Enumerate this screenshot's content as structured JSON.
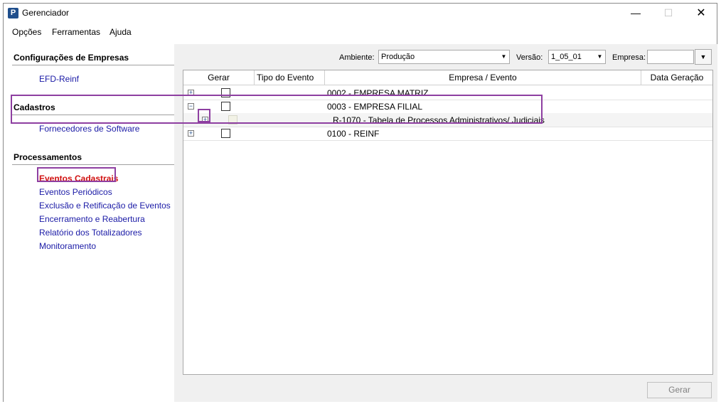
{
  "window": {
    "title": "Gerenciador",
    "app_icon": "P",
    "controls": {
      "minimize": "—",
      "maximize": "☐",
      "close": "✕"
    }
  },
  "menu": [
    "Opções",
    "Ferramentas",
    "Ajuda"
  ],
  "sidebar": {
    "sections": [
      {
        "title": "Configurações de Empresas",
        "links": [
          "EFD-Reinf"
        ]
      },
      {
        "title": "Cadastros",
        "links": [
          "Fornecedores de Software"
        ]
      },
      {
        "title": "Processamentos",
        "links": [
          "Eventos Cadastrais",
          "Eventos Periódicos",
          "Exclusão e Retificação de Eventos",
          "Encerramento e Reabertura",
          "Relatório dos Totalizadores",
          "Monitoramento"
        ]
      }
    ],
    "active_link": "Eventos Cadastrais"
  },
  "filters": {
    "ambiente_label": "Ambiente:",
    "ambiente_value": "Produção",
    "versao_label": "Versão:",
    "versao_value": "1_05_01",
    "empresa_label": "Empresa:",
    "empresa_value": ""
  },
  "grid": {
    "columns": [
      "Gerar",
      "Tipo do Evento",
      "Empresa / Evento",
      "Data Geração"
    ],
    "rows": [
      {
        "expander": "+",
        "empresa_evento": "0002 - EMPRESA MATRIZ"
      },
      {
        "expander": "−",
        "empresa_evento": "0003 - EMPRESA FILIAL"
      },
      {
        "expander": "+",
        "empresa_evento": "R-1070 - Tabela de Processos Administrativos/ Judiciais"
      },
      {
        "expander": "+",
        "empresa_evento": "0100 - REINF"
      }
    ]
  },
  "actions": {
    "gerar_label": "Gerar"
  },
  "colors": {
    "link": "#1a1aa6",
    "active_link": "#d01010",
    "highlight": "#8e3fa1"
  }
}
